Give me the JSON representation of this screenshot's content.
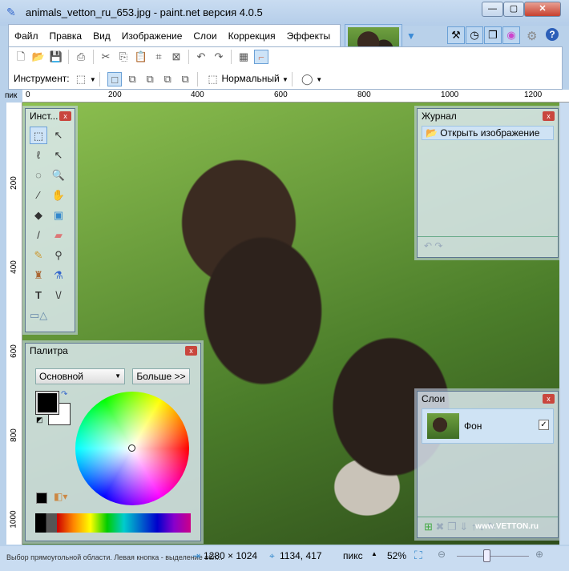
{
  "window": {
    "title": "animals_vetton_ru_653.jpg - paint.net версия 4.0.5"
  },
  "menu": [
    "Файл",
    "Правка",
    "Вид",
    "Изображение",
    "Слои",
    "Коррекция",
    "Эффекты"
  ],
  "tool_options": {
    "label": "Инструмент:",
    "blend_mode": "Нормальный"
  },
  "ruler": {
    "unit": "пик",
    "h_ticks": [
      "0",
      "200",
      "400",
      "600",
      "800",
      "1000",
      "1200"
    ],
    "v_ticks": [
      "200",
      "400",
      "600",
      "800",
      "1000"
    ]
  },
  "tools_panel": {
    "title": "Инст..."
  },
  "history_panel": {
    "title": "Журнал",
    "items": [
      "Открыть изображение"
    ]
  },
  "layers_panel": {
    "title": "Слои",
    "layers": [
      {
        "name": "Фон",
        "visible": true
      }
    ],
    "watermark": "www.VETTON.ru"
  },
  "palette_panel": {
    "title": "Палитра",
    "mode": "Основной",
    "more_button": "Больше >>",
    "primary_color": "#000000",
    "secondary_color": "#ffffff"
  },
  "status": {
    "hint": "Выбор прямоугольной области. Левая кнопка - выделение обл...",
    "image_size": "1280 × 1024",
    "cursor": "1134, 417",
    "units": "пикс",
    "zoom": "52%",
    "zoom_slider_percent": 52
  }
}
